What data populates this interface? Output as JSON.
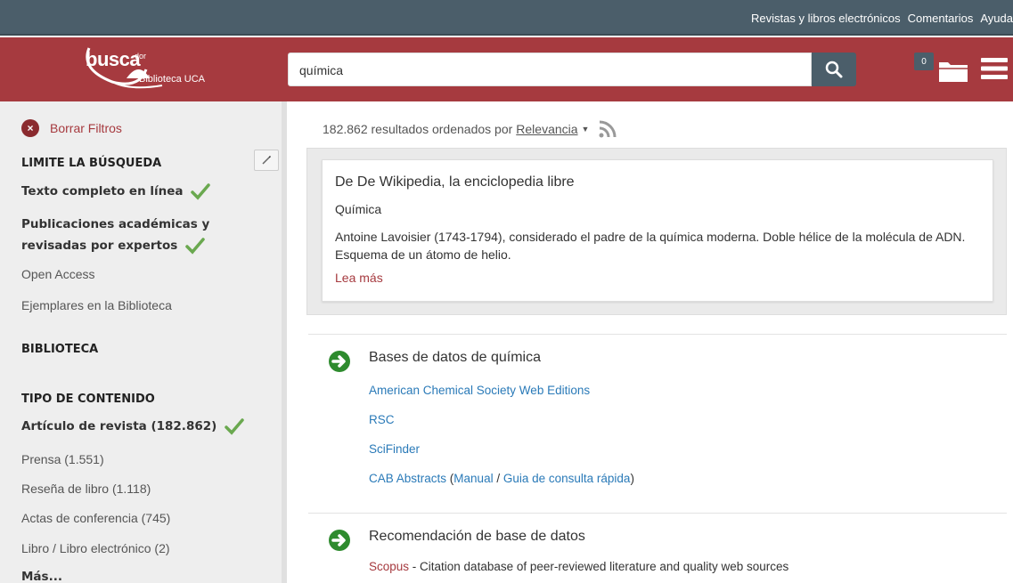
{
  "topbar": {
    "links": [
      "Revistas y libros electrónicos",
      "Comentarios",
      "Ayuda"
    ]
  },
  "header": {
    "logo": {
      "main": "busca",
      "sup": "dor",
      "sub": "Biblioteca UCA"
    },
    "search_value": "química",
    "folder_count": "0"
  },
  "sidebar": {
    "clear_filters": "Borrar Filtros",
    "limit_heading": "LIMITE LA BÚSQUEDA",
    "limit_items": [
      {
        "label": "Texto completo en línea"
      },
      {
        "label_line1": "Publicaciones académicas y",
        "label_line2": "revisadas por expertos"
      },
      {
        "label": "Open Access"
      },
      {
        "label": "Ejemplares en la Biblioteca"
      }
    ],
    "library_heading": "BIBLIOTECA",
    "content_heading": "TIPO DE CONTENIDO",
    "content_items": [
      {
        "label": "Artículo de revista (182.862)"
      },
      {
        "label": "Prensa (1.551)"
      },
      {
        "label": "Reseña de libro (1.118)"
      },
      {
        "label": "Actas de conferencia (745)"
      },
      {
        "label": "Libro / Libro electrónico (2)"
      },
      {
        "label": "Más..."
      }
    ]
  },
  "results": {
    "summary": "182.862 resultados ordenados por",
    "sort": "Relevancia"
  },
  "wiki": {
    "source": "De De Wikipedia, la enciclopedia libre",
    "title": "Química",
    "snippet": "Antoine Lavoisier (1743-1794), considerado el padre de la química moderna. Doble hélice de la molécula de ADN. Esquema de un átomo de helio.",
    "more": "Lea más"
  },
  "databases": {
    "title": "Bases de datos de química",
    "links": [
      "American Chemical Society Web Editions",
      "RSC",
      "SciFinder"
    ],
    "cab": {
      "name": "CAB Abstracts",
      "open": " (",
      "manual": "Manual",
      "sep": " / ",
      "guide": "Guia de consulta rápida",
      "close": ")"
    }
  },
  "recommendation": {
    "title": "Recomendación de base de datos",
    "link": "Scopus",
    "desc": " - Citation database of peer-reviewed literature and quality web sources"
  },
  "colors": {
    "brand": "#a63a3f",
    "topbar": "#4b5e6a",
    "check": "#6aa84f",
    "link": "#2a7ab8",
    "arrow": "#2e8b2e"
  }
}
